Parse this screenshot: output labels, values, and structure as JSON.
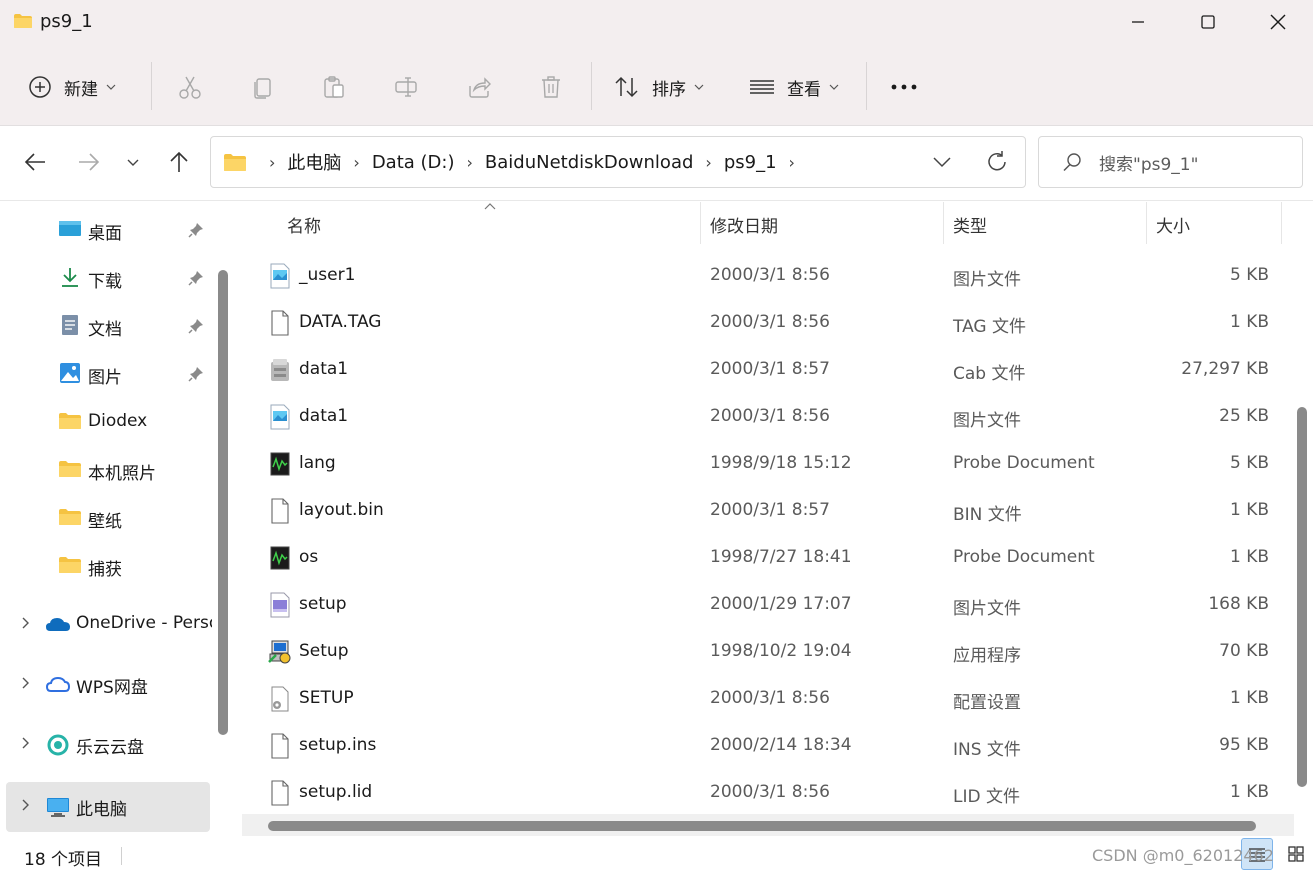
{
  "window": {
    "title": "ps9_1"
  },
  "toolbar": {
    "new_label": "新建",
    "sort_label": "排序",
    "view_label": "查看",
    "more_label": "•••"
  },
  "address": {
    "crumbs": [
      "此电脑",
      "Data (D:)",
      "BaiduNetdiskDownload",
      "ps9_1"
    ],
    "search_placeholder": "搜索\"ps9_1\""
  },
  "sidebar": {
    "quick_items": [
      {
        "label": "桌面",
        "icon": "desktop-icon",
        "pinned": true
      },
      {
        "label": "下载",
        "icon": "download-icon",
        "pinned": true
      },
      {
        "label": "文档",
        "icon": "documents-icon",
        "pinned": true
      },
      {
        "label": "图片",
        "icon": "pictures-icon",
        "pinned": true
      },
      {
        "label": "Diodex",
        "icon": "folder-icon",
        "pinned": false
      },
      {
        "label": "本机照片",
        "icon": "folder-icon",
        "pinned": false
      },
      {
        "label": "壁纸",
        "icon": "folder-icon",
        "pinned": false
      },
      {
        "label": "捕获",
        "icon": "folder-icon",
        "pinned": false
      }
    ],
    "groups": [
      {
        "label": "OneDrive - Personal",
        "icon": "onedrive-icon"
      },
      {
        "label": "WPS网盘",
        "icon": "wps-cloud-icon"
      },
      {
        "label": "乐云云盘",
        "icon": "leyun-cloud-icon"
      },
      {
        "label": "此电脑",
        "icon": "this-pc-icon",
        "selected": true
      }
    ]
  },
  "columns": {
    "name": "名称",
    "date": "修改日期",
    "type": "类型",
    "size": "大小"
  },
  "files": [
    {
      "name": "_user1",
      "date": "2000/3/1 8:56",
      "type": "图片文件",
      "size": "5 KB",
      "icon": "image-file-icon"
    },
    {
      "name": "DATA.TAG",
      "date": "2000/3/1 8:56",
      "type": "TAG 文件",
      "size": "1 KB",
      "icon": "blank-file-icon"
    },
    {
      "name": "data1",
      "date": "2000/3/1 8:57",
      "type": "Cab 文件",
      "size": "27,297 KB",
      "icon": "cab-file-icon"
    },
    {
      "name": "data1",
      "date": "2000/3/1 8:56",
      "type": "图片文件",
      "size": "25 KB",
      "icon": "image-file-icon"
    },
    {
      "name": "lang",
      "date": "1998/9/18 15:12",
      "type": "Probe Document",
      "size": "5 KB",
      "icon": "probe-file-icon"
    },
    {
      "name": "layout.bin",
      "date": "2000/3/1 8:57",
      "type": "BIN 文件",
      "size": "1 KB",
      "icon": "blank-file-icon"
    },
    {
      "name": "os",
      "date": "1998/7/27 18:41",
      "type": "Probe Document",
      "size": "1 KB",
      "icon": "probe-file-icon"
    },
    {
      "name": "setup",
      "date": "2000/1/29 17:07",
      "type": "图片文件",
      "size": "168 KB",
      "icon": "bmp-file-icon"
    },
    {
      "name": "Setup",
      "date": "1998/10/2 19:04",
      "type": "应用程序",
      "size": "70 KB",
      "icon": "setup-exe-icon"
    },
    {
      "name": "SETUP",
      "date": "2000/3/1 8:56",
      "type": "配置设置",
      "size": "1 KB",
      "icon": "config-file-icon"
    },
    {
      "name": "setup.ins",
      "date": "2000/2/14 18:34",
      "type": "INS 文件",
      "size": "95 KB",
      "icon": "blank-file-icon"
    },
    {
      "name": "setup.lid",
      "date": "2000/3/1 8:56",
      "type": "LID 文件",
      "size": "1 KB",
      "icon": "blank-file-icon"
    }
  ],
  "status": {
    "count": "18 个项目"
  },
  "watermark": "CSDN @m0_62012462",
  "colors": {
    "titlebar_bg": "#f3eeef",
    "folder_yellow": "#f5c342",
    "accent_blue": "#0067c0",
    "selected_bg": "#e5e5e5"
  }
}
